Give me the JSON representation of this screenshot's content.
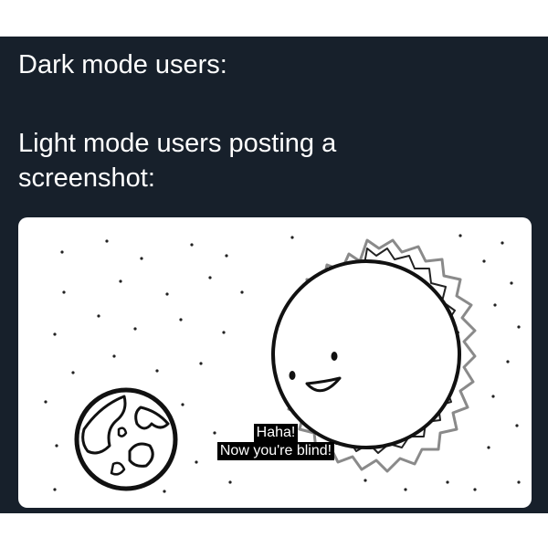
{
  "caption": {
    "line1": "Dark mode users:",
    "line2": "Light mode users posting a",
    "line3": "screenshot:"
  },
  "comic": {
    "subtitle_line1": "Haha!",
    "subtitle_line2": "Now you're blind!",
    "sun_icon": "smiling-sun",
    "earth_icon": "earth-globe"
  },
  "colors": {
    "background": "#17202b",
    "text": "#ffffff",
    "card": "#ffffff"
  }
}
